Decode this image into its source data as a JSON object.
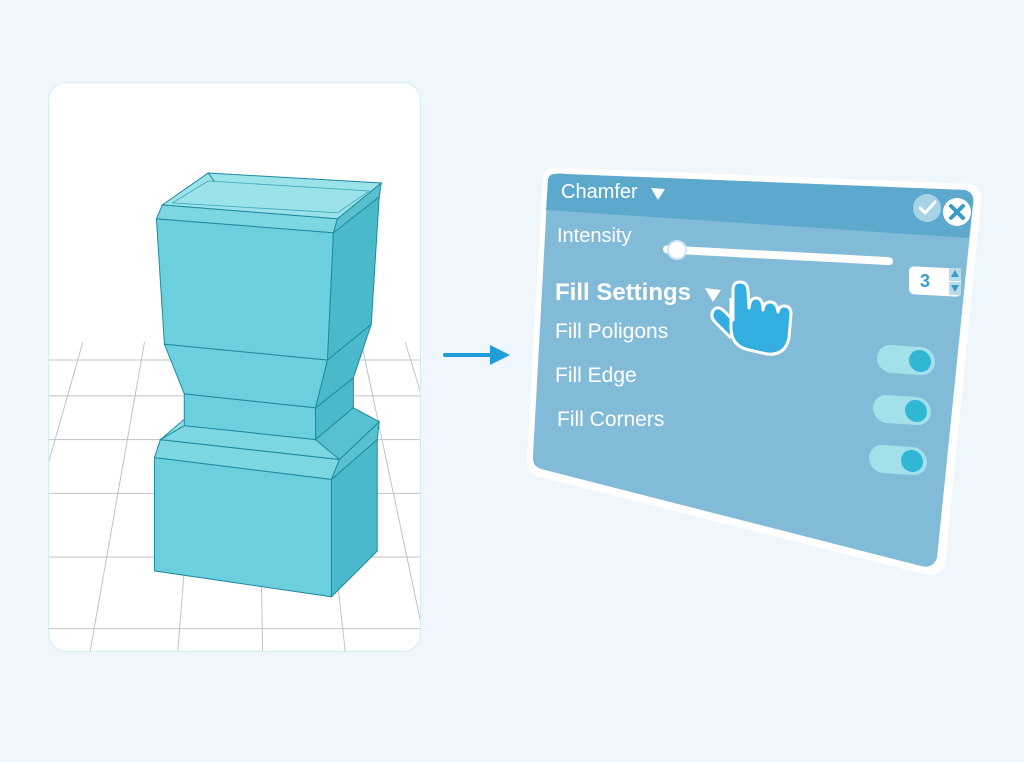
{
  "panel": {
    "title": "Chamfer",
    "intensity_label": "Intensity",
    "intensity_value": "3",
    "section_title": "Fill Settings",
    "options": {
      "polygons": "Fill Poligons",
      "edge": "Fill Edge",
      "corners": "Fill Corners"
    },
    "toggles": {
      "polygons": true,
      "edge": true,
      "corners": true
    }
  },
  "colors": {
    "panel_header": "#3a9bc6",
    "panel_body": "#82bbd8",
    "accent": "#1f9dd9",
    "model": "#6ccfdd",
    "grid": "#b3b7bd"
  }
}
